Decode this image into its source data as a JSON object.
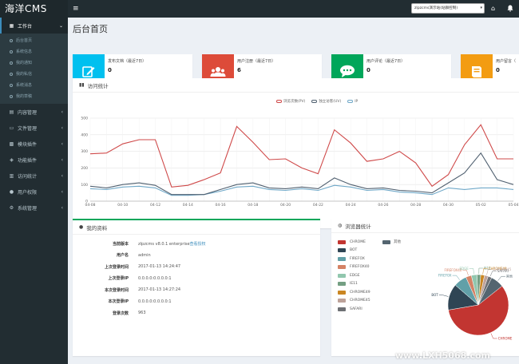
{
  "app": {
    "brand": "海洋CMS"
  },
  "topbar": {
    "toggle_icon": "menu-icon",
    "site_select": "zlpzcms演示站(站群控制)",
    "home_icon": "home-icon",
    "bell_icon": "bell-icon"
  },
  "sidebar": {
    "items": [
      {
        "label": "工作台",
        "icon": "dashboard-icon",
        "active": true
      },
      {
        "label": "内容管理",
        "icon": "content-icon"
      },
      {
        "label": "文件管理",
        "icon": "file-icon"
      },
      {
        "label": "模块插件",
        "icon": "plugin-icon"
      },
      {
        "label": "功能插件",
        "icon": "feature-icon"
      },
      {
        "label": "访问统计",
        "icon": "stats-icon"
      },
      {
        "label": "用户权限",
        "icon": "user-icon"
      },
      {
        "label": "系统管理",
        "icon": "gear-icon"
      }
    ],
    "sub_items": [
      "后台首页",
      "系统信息",
      "我的通知",
      "我的私信",
      "系统消息",
      "我的草稿"
    ]
  },
  "page": {
    "title": "后台首页"
  },
  "stats": [
    {
      "label": "发布文档（最近7日）",
      "value": "0",
      "color": "#00c0ef",
      "icon": "edit-icon"
    },
    {
      "label": "用户注册（最近7日）",
      "value": "6",
      "color": "#dd4b39",
      "icon": "users-icon"
    },
    {
      "label": "用户评论（最近7日）",
      "value": "0",
      "color": "#00a65a",
      "icon": "comment-icon"
    },
    {
      "label": "用户留言（",
      "value": "0",
      "color": "#f39c12",
      "icon": "book-icon"
    }
  ],
  "visits": {
    "title": "访问统计",
    "icon": "bar-chart-icon"
  },
  "chart_data": [
    {
      "type": "line",
      "title": "访问统计",
      "categories": [
        "04-08",
        "04-09",
        "04-10",
        "04-11",
        "04-12",
        "04-13",
        "04-14",
        "04-15",
        "04-16",
        "04-17",
        "04-18",
        "04-19",
        "04-20",
        "04-21",
        "04-22",
        "04-23",
        "04-24",
        "04-25",
        "04-26",
        "04-27",
        "04-28",
        "04-29",
        "04-30",
        "05-01",
        "05-02",
        "05-03",
        "05-04"
      ],
      "x_tick_labels": [
        "04-08",
        "04-10",
        "04-12",
        "04-14",
        "04-16",
        "04-18",
        "04-20",
        "04-22",
        "04-24",
        "04-26",
        "04-28",
        "04-30",
        "05-02",
        "05-04"
      ],
      "ylim": [
        0,
        500
      ],
      "y_ticks": [
        0,
        100,
        200,
        300,
        400,
        500
      ],
      "grid": true,
      "legend_position": "top-center",
      "series": [
        {
          "name": "浏览次数(PV)",
          "color": "#cf4949",
          "values": [
            285,
            290,
            345,
            370,
            370,
            85,
            95,
            130,
            170,
            450,
            355,
            250,
            255,
            200,
            165,
            430,
            350,
            240,
            255,
            300,
            230,
            90,
            160,
            340,
            460,
            255,
            255
          ]
        },
        {
          "name": "独立访客(UV)",
          "color": "#506070",
          "values": [
            90,
            80,
            100,
            110,
            95,
            40,
            40,
            40,
            70,
            100,
            110,
            80,
            75,
            85,
            75,
            140,
            100,
            75,
            80,
            65,
            60,
            50,
            110,
            170,
            290,
            130,
            100
          ]
        },
        {
          "name": "IP",
          "color": "#6fa8c8",
          "values": [
            75,
            70,
            85,
            90,
            80,
            35,
            35,
            40,
            60,
            85,
            90,
            70,
            65,
            75,
            65,
            95,
            85,
            65,
            70,
            55,
            50,
            40,
            80,
            70,
            80,
            80,
            70
          ]
        }
      ]
    },
    {
      "type": "pie",
      "title": "浏览器统计",
      "legend_position": "left",
      "series": [
        {
          "name": "CHROME",
          "color": "#c23531",
          "value": 58
        },
        {
          "name": "BOT",
          "color": "#2f4554",
          "value": 14
        },
        {
          "name": "FIREFOX",
          "color": "#61a0a8",
          "value": 7
        },
        {
          "name": "FIREFOX40",
          "color": "#d48265",
          "value": 3
        },
        {
          "name": "EDGE",
          "color": "#91c7ae",
          "value": 3
        },
        {
          "name": "IE11",
          "color": "#749f83",
          "value": 2
        },
        {
          "name": "CHROME49",
          "color": "#ca8622",
          "value": 2
        },
        {
          "name": "CHROME45",
          "color": "#bda29a",
          "value": 2
        },
        {
          "name": "SAFARI",
          "color": "#6e7074",
          "value": 2
        },
        {
          "name": "其他",
          "color": "#546570",
          "value": 7
        }
      ]
    }
  ],
  "profile": {
    "title": "我的资料",
    "icon": "user-icon",
    "rows": [
      {
        "key": "当前版本",
        "value": "zlpzcms v8.0.1 enterprise",
        "link": "查看授权"
      },
      {
        "key": "用户名",
        "value": "admin"
      },
      {
        "key": "上次登录时间",
        "value": "2017-01-13 14:24:47"
      },
      {
        "key": "上次登录IP",
        "value": "0.0.0.0:0.0.0.0:1"
      },
      {
        "key": "本次登录时间",
        "value": "2017-01-13 14:27:24"
      },
      {
        "key": "本次登录IP",
        "value": "0.0.0.0:0.0.0.0:1"
      },
      {
        "key": "登录次数",
        "value": "963"
      }
    ]
  },
  "browsers": {
    "title": "浏览器统计",
    "icon": "globe-icon"
  },
  "watermark": "www.LXH5068.com"
}
